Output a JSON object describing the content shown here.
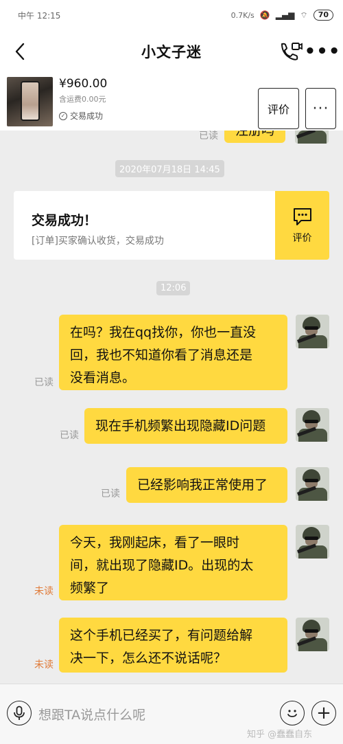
{
  "status_bar": {
    "time": "中午 12:15",
    "network": "0.7K/s",
    "battery": "70"
  },
  "nav": {
    "title": "小文子迷"
  },
  "product": {
    "price": "¥960.00",
    "shipping": "含运费0.00元",
    "status": "交易成功",
    "review_label": "评价",
    "more_label": "···"
  },
  "chat": {
    "partial_top": {
      "read_label": "已读",
      "text": "注册吗"
    },
    "timestamp1": "2020年07月18日 14:45",
    "order_card": {
      "title": "交易成功！",
      "desc": "[订单]买家确认收货，交易成功",
      "action_label": "评价"
    },
    "timestamp2": "12:06",
    "messages": [
      {
        "status": "已读",
        "text": [
          "在吗？我在qq找你，你也一直没",
          "回，我也不知道你看了消息还是",
          "没看消息。"
        ]
      },
      {
        "status": "已读",
        "text": [
          "现在手机频繁出现隐藏ID问题"
        ]
      },
      {
        "status": "已读",
        "text": [
          "已经影响我正常使用了"
        ]
      },
      {
        "status": "未读",
        "text": [
          "今天，我刚起床，看了一眼时",
          "间，就出现了隐藏ID。出现的太",
          "频繁了"
        ]
      },
      {
        "status": "未读",
        "text": [
          "这个手机已经买了，有问题给解",
          "决一下，怎么还不说话呢？"
        ]
      }
    ]
  },
  "input": {
    "placeholder": "想跟TA说点什么呢"
  },
  "watermark": "知乎 @蠢蠢自东",
  "colors": {
    "bubble": "#ffd940",
    "unread": "#e07a38",
    "background": "#ededed"
  }
}
